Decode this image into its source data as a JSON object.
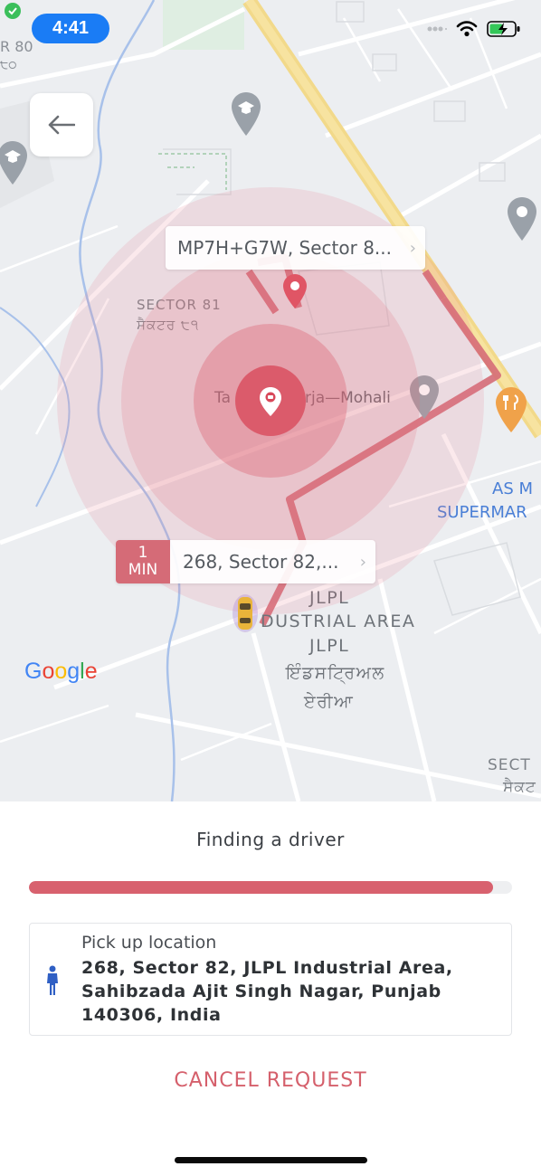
{
  "status_bar": {
    "time": "4:41",
    "icons": [
      "signal-dots-icon",
      "wifi-icon",
      "battery-charging-icon"
    ]
  },
  "map": {
    "back_icon": "arrow-left-icon",
    "labels": {
      "top_left_code": "R 80",
      "top_left_code2": "੮੦",
      "sector81": "SECTOR 81",
      "sector81_pa": "ਸੈਕਟਰ ੮੧",
      "tata": "Ta",
      "tata2": "rja—Mohali",
      "as_ma": "AS M",
      "supermar": "SUPERMAR",
      "jlpl1": "JLPL",
      "industrial": "DUSTRIAL AREA",
      "jlpl2": "JLPL",
      "industrial_pa1": "ਇੰਡਸਟ੍ਰਿਅਲ",
      "industrial_pa2": "ਏਰੀਆ",
      "sect": "SECT",
      "sect_pa": "ਸੈਕਟ"
    },
    "dropoff_callout": "MP7H+G7W, Sector 8...",
    "pickup_callout": {
      "eta_value": "1",
      "eta_unit": "MIN",
      "address": "268, Sector 82,..."
    },
    "google": [
      "G",
      "o",
      "o",
      "g",
      "l",
      "e"
    ]
  },
  "sheet": {
    "status": "Finding a driver",
    "progress": 0.96,
    "pickup_label": "Pick up location",
    "pickup_address": "268, Sector 82, JLPL Industrial Area, Sahibzada Ajit Singh Nagar, Punjab 140306, India",
    "cancel_label": "CANCEL REQUEST"
  },
  "colors": {
    "accent": "#d8616e",
    "status_time_bg": "#1a7cf5",
    "route": "#d56b77"
  }
}
